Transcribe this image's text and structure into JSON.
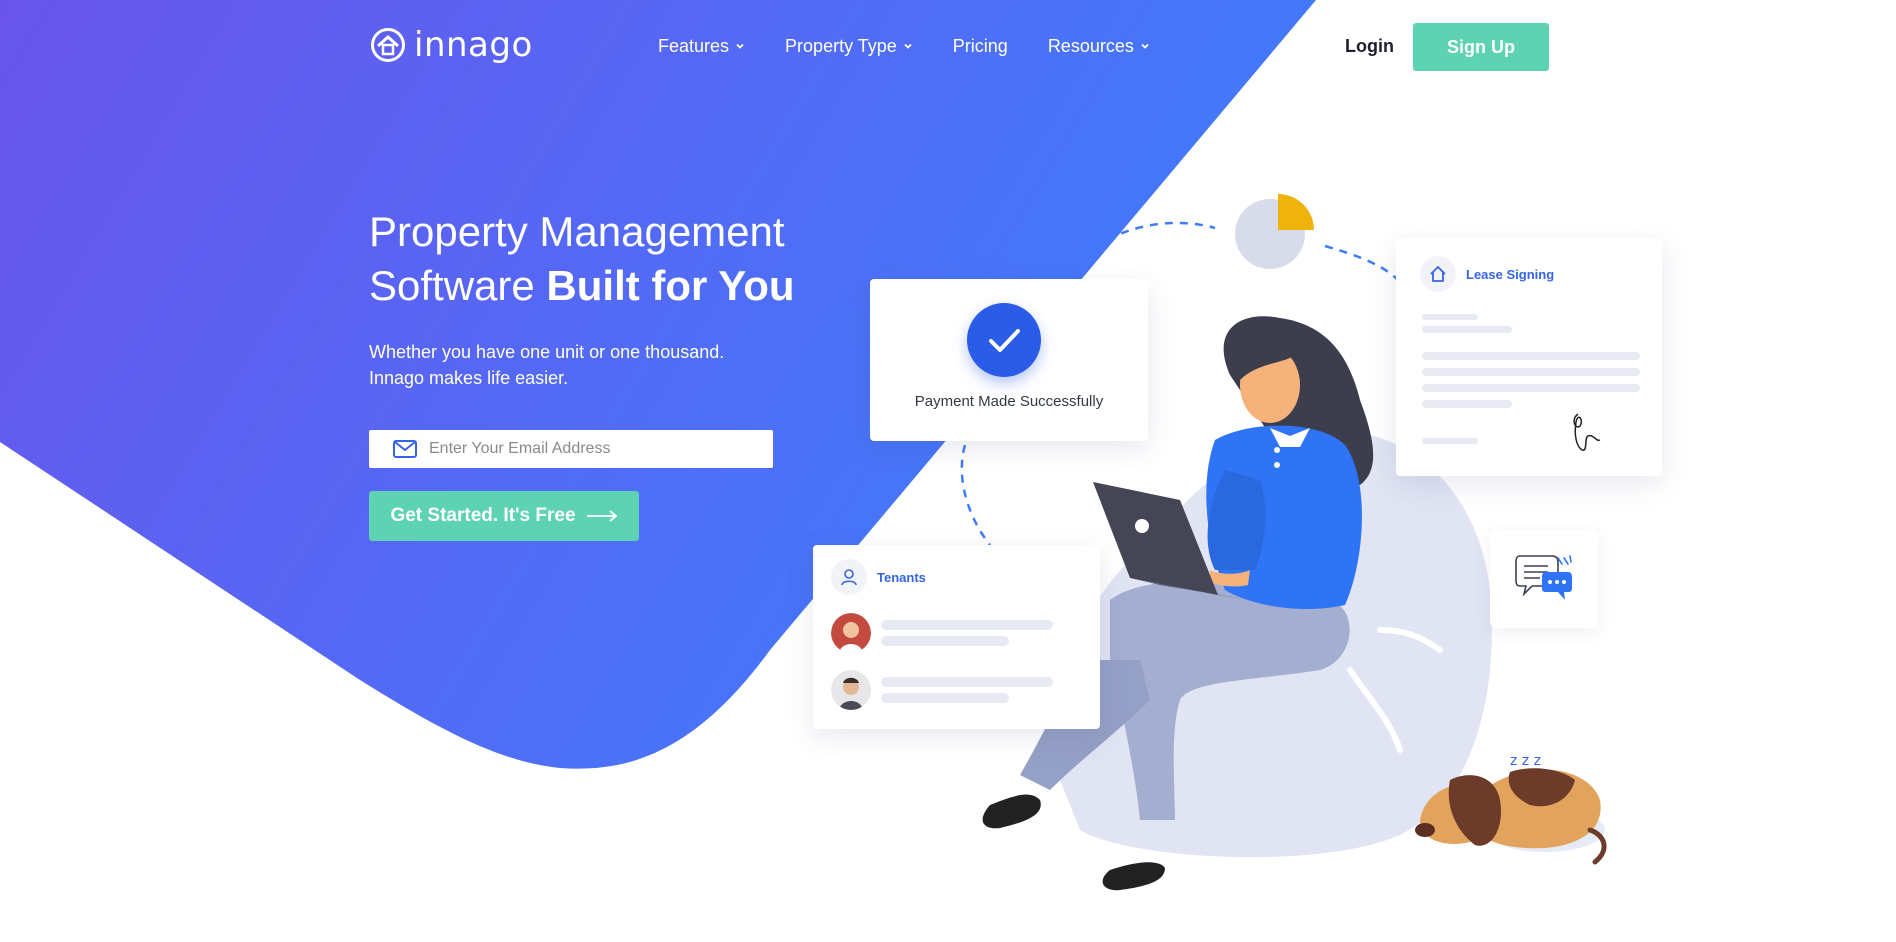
{
  "brand": {
    "name": "innago",
    "logo_icon": "house-circle-logo"
  },
  "nav": {
    "items": [
      {
        "label": "Features",
        "has_dropdown": true
      },
      {
        "label": "Property Type",
        "has_dropdown": true
      },
      {
        "label": "Pricing",
        "has_dropdown": false
      },
      {
        "label": "Resources",
        "has_dropdown": true
      }
    ],
    "login_label": "Login",
    "signup_label": "Sign Up"
  },
  "hero": {
    "title_line1": "Property Management",
    "title_line2_regular": "Software ",
    "title_line2_bold": "Built for You",
    "subtitle_line1": "Whether you have one unit or one thousand.",
    "subtitle_line2": "Innago makes life easier.",
    "email_placeholder": "Enter Your Email Address",
    "cta_label": "Get Started. It's Free"
  },
  "illustration": {
    "payment_card_text": "Payment Made Successfully",
    "lease_card_title": "Lease Signing",
    "tenants_card_title": "Tenants"
  },
  "colors": {
    "gradient_start": "#6a55ec",
    "gradient_end": "#3f7cfb",
    "accent_green": "#5dd3b3",
    "link_blue": "#3565e6"
  }
}
